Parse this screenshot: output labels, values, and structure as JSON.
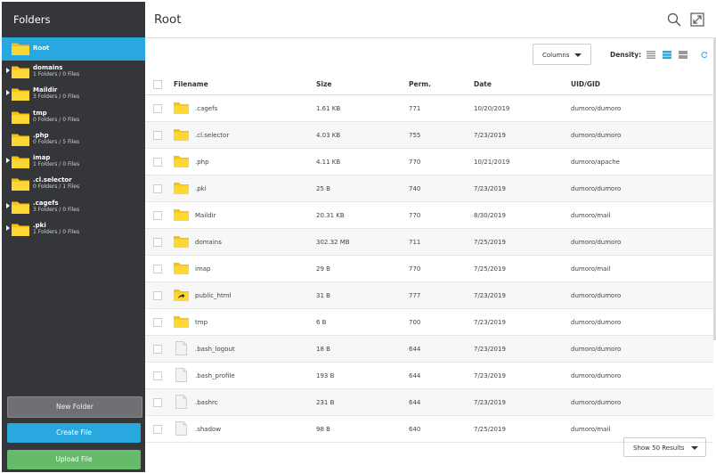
{
  "sidebar": {
    "title": "Folders",
    "items": [
      {
        "name": "Root",
        "meta": "",
        "expandable": false
      },
      {
        "name": "domains",
        "meta": "1 Folders / 0 Files",
        "expandable": true
      },
      {
        "name": "Maildir",
        "meta": "3 Folders / 0 Files",
        "expandable": true
      },
      {
        "name": "tmp",
        "meta": "0 Folders / 0 Files",
        "expandable": false
      },
      {
        "name": ".php",
        "meta": "0 Folders / 5 Files",
        "expandable": false
      },
      {
        "name": "imap",
        "meta": "1 Folders / 0 Files",
        "expandable": true
      },
      {
        "name": ".cl.selector",
        "meta": "0 Folders / 1 Files",
        "expandable": false
      },
      {
        "name": ".cagefs",
        "meta": "3 Folders / 0 Files",
        "expandable": true
      },
      {
        "name": ".pki",
        "meta": "1 Folders / 0 Files",
        "expandable": true
      }
    ],
    "buttons": {
      "new_folder": "New Folder",
      "create_file": "Create File",
      "upload_file": "Upload File"
    }
  },
  "main": {
    "title": "Root",
    "toolbar": {
      "columns_label": "Columns",
      "density_label": "Density:"
    },
    "columns": [
      "Filename",
      "Size",
      "Perm.",
      "Date",
      "UID/GID"
    ],
    "rows": [
      {
        "name": ".cagefs",
        "size": "1.61 KB",
        "perm": "771",
        "date": "10/20/2019",
        "uid": "dumoro/dumoro",
        "icon": "folder-icon"
      },
      {
        "name": ".cl.selector",
        "size": "4.03 KB",
        "perm": "755",
        "date": "7/23/2019",
        "uid": "dumoro/dumoro",
        "icon": "folder-icon"
      },
      {
        "name": ".php",
        "size": "4.11 KB",
        "perm": "770",
        "date": "10/21/2019",
        "uid": "dumoro/apache",
        "icon": "folder-icon"
      },
      {
        "name": ".pki",
        "size": "25 B",
        "perm": "740",
        "date": "7/23/2019",
        "uid": "dumoro/dumoro",
        "icon": "folder-icon"
      },
      {
        "name": "Maildir",
        "size": "20.31 KB",
        "perm": "770",
        "date": "8/30/2019",
        "uid": "dumoro/mail",
        "icon": "folder-icon"
      },
      {
        "name": "domains",
        "size": "302.32 MB",
        "perm": "711",
        "date": "7/25/2019",
        "uid": "dumoro/dumoro",
        "icon": "folder-icon"
      },
      {
        "name": "imap",
        "size": "29 B",
        "perm": "770",
        "date": "7/25/2019",
        "uid": "dumoro/mail",
        "icon": "folder-icon"
      },
      {
        "name": "public_html",
        "size": "31 B",
        "perm": "777",
        "date": "7/23/2019",
        "uid": "dumoro/dumoro",
        "icon": "folder-link-icon"
      },
      {
        "name": "tmp",
        "size": "6 B",
        "perm": "700",
        "date": "7/23/2019",
        "uid": "dumoro/dumoro",
        "icon": "folder-icon"
      },
      {
        "name": ".bash_logout",
        "size": "18 B",
        "perm": "644",
        "date": "7/23/2019",
        "uid": "dumoro/dumoro",
        "icon": "document-icon"
      },
      {
        "name": ".bash_profile",
        "size": "193 B",
        "perm": "644",
        "date": "7/23/2019",
        "uid": "dumoro/dumoro",
        "icon": "document-icon"
      },
      {
        "name": ".bashrc",
        "size": "231 B",
        "perm": "644",
        "date": "7/23/2019",
        "uid": "dumoro/dumoro",
        "icon": "document-icon"
      },
      {
        "name": ".shadow",
        "size": "98 B",
        "perm": "640",
        "date": "7/25/2019",
        "uid": "dumoro/mail",
        "icon": "document-icon"
      }
    ],
    "footer": {
      "show_results": "Show 50 Results"
    }
  },
  "colors": {
    "accent": "#29a8e0",
    "sidebar_bg": "#34363a",
    "upload_green": "#66bb6a",
    "folder_yellow": "#f7c20d"
  }
}
